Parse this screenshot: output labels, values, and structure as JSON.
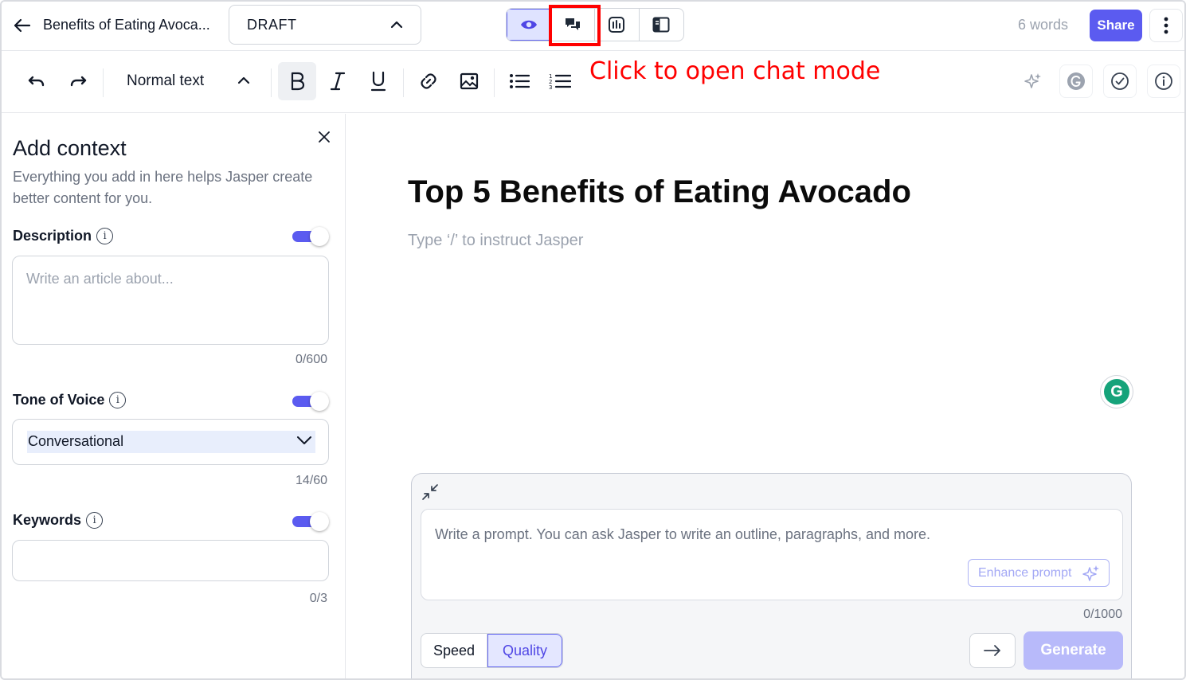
{
  "header": {
    "doc_title": "Benefits of Eating Avoca...",
    "status": "DRAFT",
    "word_count": "6 words",
    "share_label": "Share",
    "view_modes": [
      "preview-icon",
      "chat-icon",
      "analytics-icon",
      "sidebar-layout-icon"
    ],
    "active_view_mode": "preview"
  },
  "toolbar": {
    "text_style": "Normal text"
  },
  "annotation": {
    "text": "Click to open chat mode",
    "color": "#ff0000"
  },
  "sidebar": {
    "title": "Add context",
    "subtitle": "Everything you add in here helps Jasper create better content for you.",
    "description": {
      "label": "Description",
      "placeholder": "Write an article about...",
      "counter": "0/600",
      "enabled": true
    },
    "tone": {
      "label": "Tone of Voice",
      "value": "Conversational",
      "counter": "14/60",
      "enabled": true
    },
    "keywords": {
      "label": "Keywords",
      "counter": "0/3",
      "enabled": true
    }
  },
  "editor": {
    "heading": "Top 5 Benefits of Eating Avocado",
    "placeholder": "Type ‘/’ to instruct Jasper"
  },
  "prompt": {
    "placeholder": "Write a prompt. You can ask Jasper to write an outline, paragraphs, and more.",
    "enhance_label": "Enhance prompt",
    "counter": "0/1000",
    "mode_speed": "Speed",
    "mode_quality": "Quality",
    "active_mode": "Quality",
    "generate_label": "Generate"
  },
  "colors": {
    "accent": "#5b5bf0",
    "generate_disabled": "#b8bafa",
    "grammarly": "#15a37a"
  }
}
